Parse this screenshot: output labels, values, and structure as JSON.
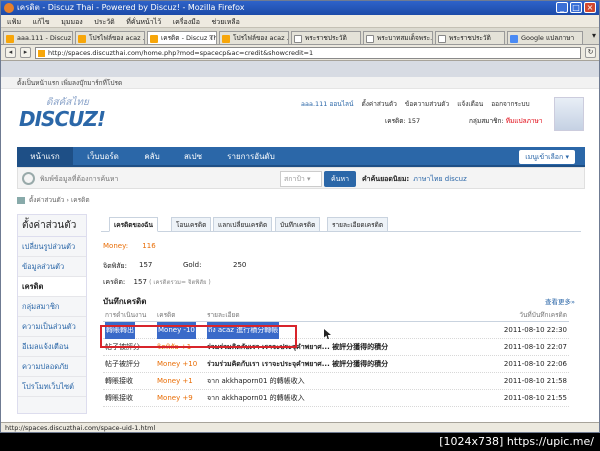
{
  "window": {
    "title": "เครดิต - Discuz Thai - Powered by Discuz! - Mozilla Firefox"
  },
  "menu": [
    "แฟ้ม",
    "แก้ไข",
    "มุมมอง",
    "ประวัติ",
    "ที่คั่นหน้าไว้",
    "เครื่องมือ",
    "ช่วยเหลือ"
  ],
  "tabs": [
    {
      "label": "aaa.111 - Discuz ...",
      "active": false
    },
    {
      "label": "โปรไฟล์ของ acaz ...",
      "active": false
    },
    {
      "label": "เครดิต - Discuz Thai",
      "active": true
    },
    {
      "label": "โปรไฟล์ของ acaz ...",
      "active": false
    },
    {
      "label": "พระราชประวัติ",
      "active": false
    },
    {
      "label": "พระบาทสมเด็จพระ...",
      "active": false
    },
    {
      "label": "พระราชประวัติ",
      "active": false
    },
    {
      "label": "Google แปลภาษา",
      "active": false
    }
  ],
  "url": "http://spaces.discuzthai.com/home.php?mod=spacecp&ac=credit&showcredit=1",
  "status": "http://spaces.discuzthai.com/space-uid-1.html",
  "corner": "[1024x738] https://upic.me/",
  "page": {
    "topline": "ตั้งเป็นหน้าแรก   เพิ่มลงบุ๊กมาร์กที่โปรด",
    "logo_th": "ดิสคัสไทย",
    "logo": "DISCUZ!",
    "user_links": [
      "aaa.111 ออนไลน์",
      "ตั้งค่าส่วนตัว",
      "ข้อความส่วนตัว",
      "แจ้งเตือน",
      "ออกจากระบบ"
    ],
    "credits_label": "เครดิต: 157",
    "group_label": "กลุ่มสมาชิก:",
    "group_value": "ทีมแปลภาษา",
    "nav": [
      "หน้าแรก",
      "เว็บบอร์ด",
      "คลับ",
      "สเปซ",
      "รายการอันดับ"
    ],
    "shortcut": "เมนูเข้าเลือก",
    "search_placeholder": "พิมพ์ข้อมูลที่ต้องการค้นหา",
    "search_scope": "สกาป้า",
    "search_button": "ค้นหา",
    "hot_label": "คำค้นยอดนิยม:",
    "hot_value": "ภาษาไทย  discuz",
    "breadcrumb": "ตั้งค่าส่วนตัว  ›  เครดิต",
    "sidebar_title": "ตั้งค่าส่วนตัว",
    "sidebar": [
      "เปลี่ยนรูปส่วนตัว",
      "ข้อมูลส่วนตัว",
      "เครดิต",
      "กลุ่มสมาชิก",
      "ความเป็นส่วนตัว",
      "อีเมลแจ้งเตือน",
      "ความปลอดภัย",
      "โปรโมทเว็บไซต์"
    ],
    "content_tabs": [
      "เครดิตของฉัน",
      "โอนเครดิต",
      "แลกเปลี่ยนเครดิต",
      "บันทึกเครดิต",
      "รายละเอียดเครดิต"
    ],
    "money_label": "Money:",
    "money_value": "116",
    "prestige_label": "จิตพิสัย:",
    "prestige_value": "157",
    "gold_label": "Gold:",
    "gold_value": "250",
    "credit_label": "เครดิต:",
    "credit_value": "157",
    "credit_note": "( เครดิตรวม= จิตพิสัย )",
    "log_title": "บันทึกเครดิต",
    "more": "查看更多»",
    "log_headers": [
      "การดำเนินงาน",
      "เครดิต",
      "รายละเอียด",
      "วันที่บันทึกเครดิต"
    ],
    "log_rows": [
      {
        "op": "轉賬轉出",
        "credit": "Money -10",
        "detail": "ถึง acaz 進行積分轉帳",
        "date": "2011-08-10 22:30"
      },
      {
        "op": "帖子被評分",
        "credit": "จิตพิสัย +1",
        "detail": "ร่วมร่วมคิดกับเรา เราจะประจุคำพยาศ... 被評分獲得的積分",
        "date": "2011-08-10 22:07"
      },
      {
        "op": "帖子被評分",
        "credit": "Money +10",
        "detail": "ร่วมร่วมคิดกับเรา เราจะประจุคำพยาศ... 被評分獲得的積分",
        "date": "2011-08-10 22:06"
      },
      {
        "op": "轉賬接收",
        "credit": "Money +1",
        "detail": "จาก akkhaporn01 的轉帳收入",
        "date": "2011-08-10 21:58"
      },
      {
        "op": "轉賬接收",
        "credit": "Money +9",
        "detail": "จาก akkhaporn01 的轉帳收入",
        "date": "2011-08-10 21:55"
      }
    ]
  }
}
